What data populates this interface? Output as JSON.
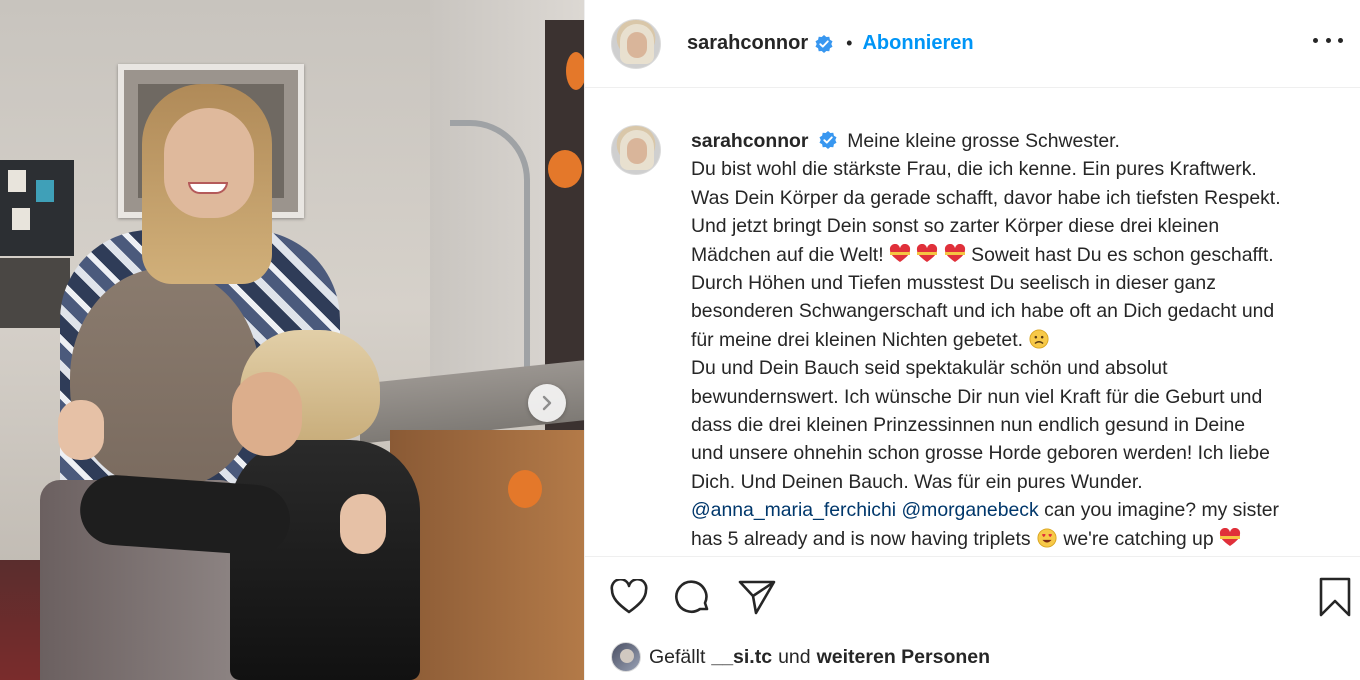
{
  "post": {
    "username": "sarahconnor",
    "follow_label": "Abonnieren",
    "separator": "•"
  },
  "caption": {
    "username": "sarahconnor",
    "lines": [
      "Meine kleine grosse Schwester.",
      "Du bist wohl die stärkste Frau, die ich kenne. Ein pures Kraftwerk.",
      "Was Dein Körper da gerade schafft, davor habe ich tiefsten Respekt.",
      "Und jetzt bringt Dein sonst so zarter Körper diese drei kleinen",
      "Mädchen auf die Welt!",
      "Soweit hast Du es schon geschafft.",
      "Durch Höhen und Tiefen musstest Du seelisch in dieser ganz",
      "besonderen Schwangerschaft und ich habe oft an Dich gedacht und",
      "für meine drei kleinen Nichten gebetet.",
      "Du und Dein Bauch seid spektakulär schön und absolut",
      "bewundernswert. Ich wünsche Dir nun viel Kraft für die Geburt und",
      "dass die drei kleinen Prinzessinnen nun endlich gesund in Deine",
      "und unsere ohnehin schon grosse Horde geboren werden! Ich liebe",
      "Dich. Und Deinen Bauch. Was für ein pures Wunder.",
      "can you imagine? my sister",
      "has 5 already and is now having triplets",
      "we're catching up"
    ],
    "mention_1": "@anna_maria_ferchichi",
    "mention_2": "@morganebeck"
  },
  "likes": {
    "prefix": "Gefällt",
    "user": "__si.tc",
    "joiner": "und",
    "suffix": "weiteren Personen"
  },
  "icons": {
    "verified": "verified-badge-icon",
    "heart": "heart-icon",
    "comment": "comment-icon",
    "share": "paper-plane-icon",
    "save": "bookmark-icon",
    "more": "more-options-icon",
    "next": "chevron-right-icon"
  },
  "colors": {
    "link": "#0095f6",
    "mention": "#00376b",
    "text": "#262626"
  }
}
